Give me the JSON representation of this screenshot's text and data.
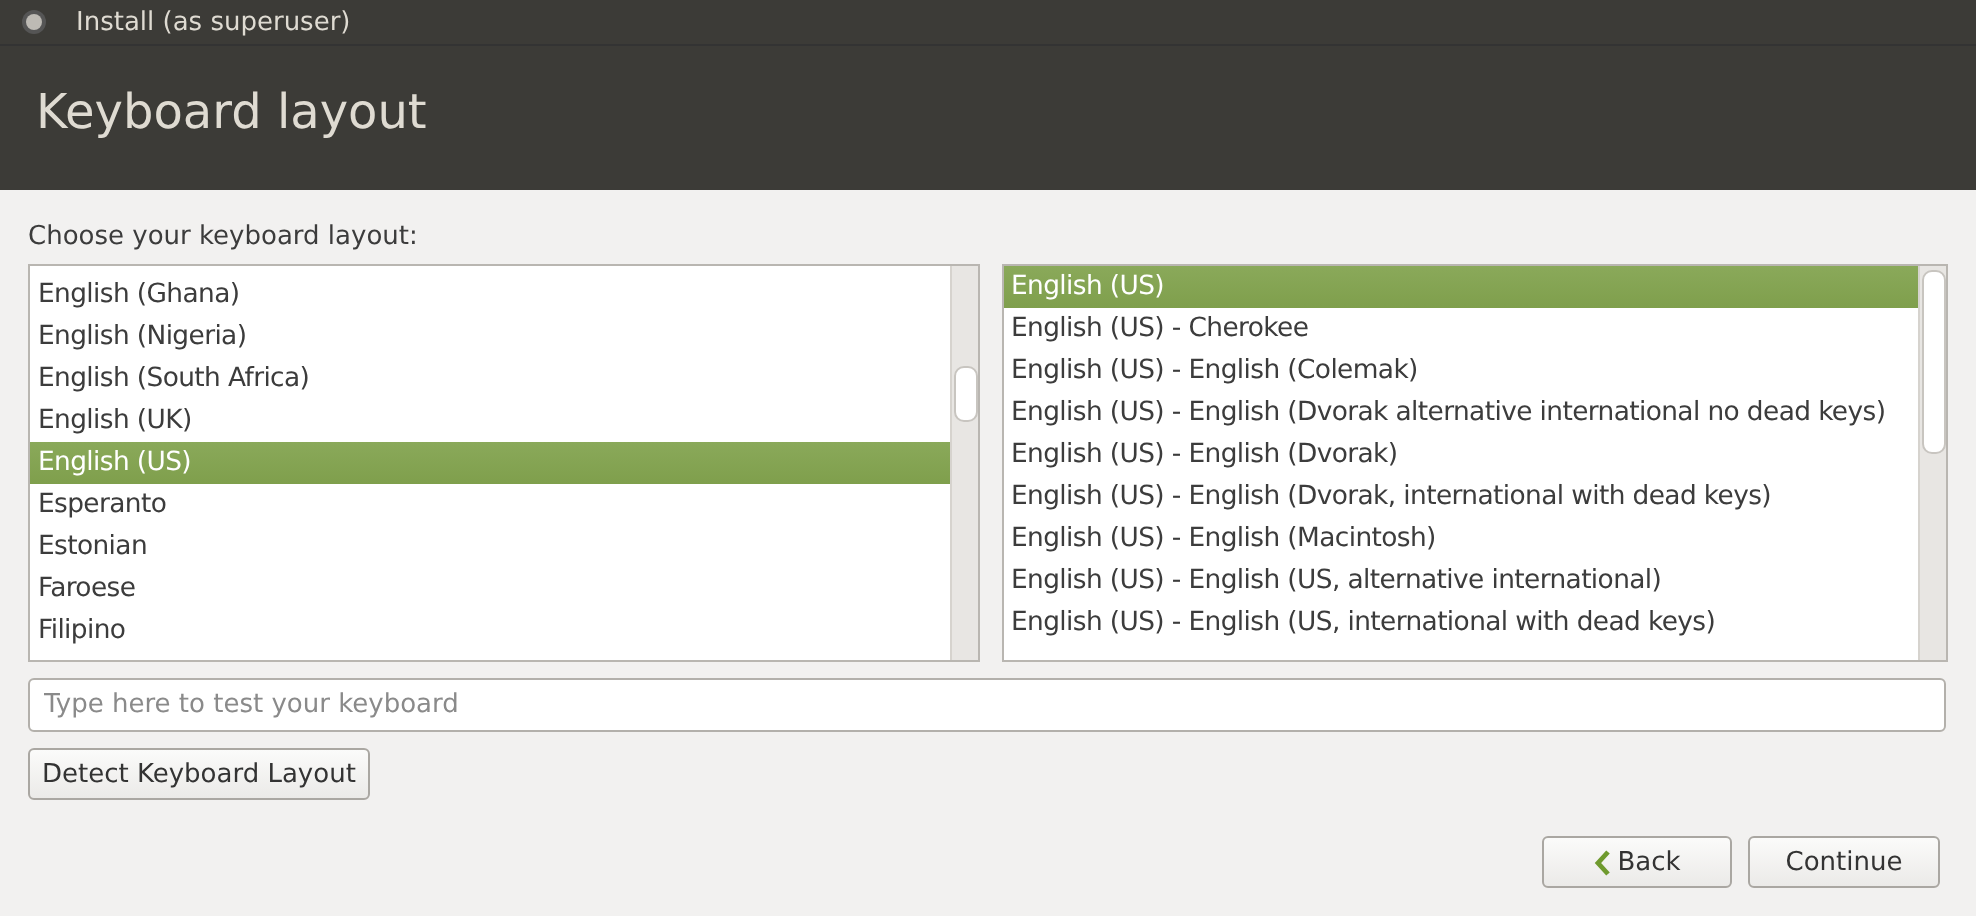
{
  "window": {
    "title": "Install (as superuser)"
  },
  "header": {
    "title": "Keyboard layout"
  },
  "prompt": "Choose your keyboard layout:",
  "layouts": [
    {
      "label": "English (Ghana)",
      "selected": false
    },
    {
      "label": "English (Nigeria)",
      "selected": false
    },
    {
      "label": "English (South Africa)",
      "selected": false
    },
    {
      "label": "English (UK)",
      "selected": false
    },
    {
      "label": "English (US)",
      "selected": true
    },
    {
      "label": "Esperanto",
      "selected": false
    },
    {
      "label": "Estonian",
      "selected": false
    },
    {
      "label": "Faroese",
      "selected": false
    },
    {
      "label": "Filipino",
      "selected": false
    }
  ],
  "variants": [
    {
      "label": "English (US)",
      "selected": true
    },
    {
      "label": "English (US) - Cherokee",
      "selected": false
    },
    {
      "label": "English (US) - English (Colemak)",
      "selected": false
    },
    {
      "label": "English (US) - English (Dvorak alternative international no dead keys)",
      "selected": false
    },
    {
      "label": "English (US) - English (Dvorak)",
      "selected": false
    },
    {
      "label": "English (US) - English (Dvorak, international with dead keys)",
      "selected": false
    },
    {
      "label": "English (US) - English (Macintosh)",
      "selected": false
    },
    {
      "label": "English (US) - English (US, alternative international)",
      "selected": false
    },
    {
      "label": "English (US) - English (US, international with dead keys)",
      "selected": false
    }
  ],
  "test_field": {
    "placeholder": "Type here to test your keyboard"
  },
  "detect_button": "Detect Keyboard Layout",
  "buttons": {
    "back": "Back",
    "continue": "Continue"
  }
}
